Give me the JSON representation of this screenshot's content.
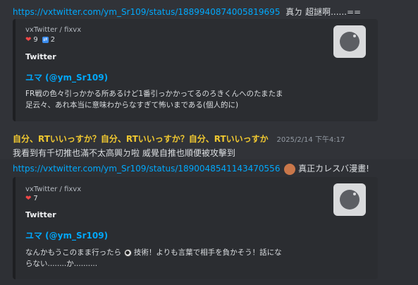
{
  "msg1": {
    "link": "https://vxtwitter.com/ym_Sr109/status/1889940874005819695",
    "after": "真ㄉ 超謎啊......=="
  },
  "embed1": {
    "provider": "vxTwitter / fixvx",
    "likes": "9",
    "retweets": "2",
    "site": "Twitter",
    "author": "ユマ (@ym_Sr109)",
    "desc_line1": "FR戦の色々引っかかる所あるけど1番引っかかってるのろきくんへのたまたま",
    "desc_line2": "足云々、あれ本当に意味わからなすぎて怖いまである(個人的に)"
  },
  "msg2": {
    "username": "自分、RTいいっすか？自分、RTいいっすか？自分、RTいいっすか",
    "timestamp": "2025/2/14 下午4:17",
    "text": "我看到有千切推也滿不太高興ㄉ啦 威覺自推也順便被攻擊到"
  },
  "msg3": {
    "link": "https://vxtwitter.com/ym_Sr109/status/1890048541143470556",
    "after": "真正カレスバ漫畫!"
  },
  "embed2": {
    "provider": "vxTwitter / fixvx",
    "likes": "7",
    "site": "Twitter",
    "author": "ユマ (@ym_Sr109)",
    "desc_line1a": "なんかもうこのまま行ったら",
    "desc_line1b": "技術！よりも言葉で相手を負かそう！話にな",
    "desc_line2": "らない........か.........."
  },
  "icons": {
    "heart": "heart-icon",
    "retweet": "retweet-icon",
    "thumbnail": "avatar-placeholder-icon",
    "emoji_face": "face-emoji-icon",
    "soccer": "soccer-ball-emoji-icon"
  }
}
